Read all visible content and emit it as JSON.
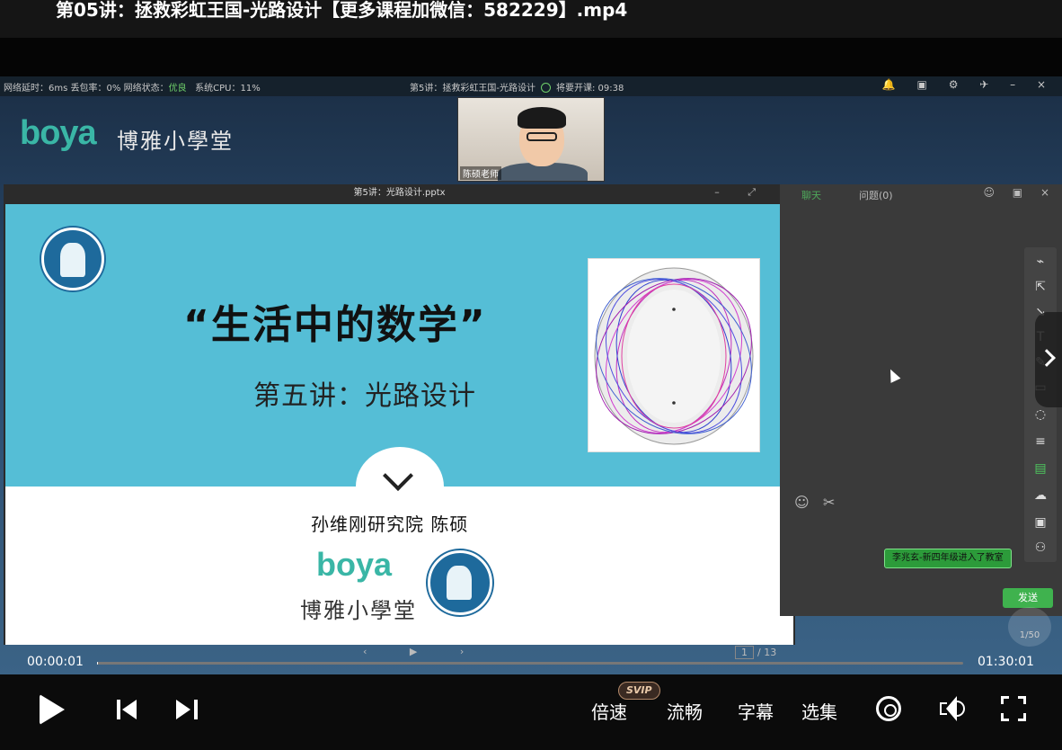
{
  "window": {
    "title": "第05讲：拯救彩虹王国-光路设计【更多课程加微信：582229】.mp4"
  },
  "classroom": {
    "status": {
      "latency_label": "网络延时：",
      "latency_value": "6ms",
      "loss_label": "丢包率：",
      "loss_value": "0%",
      "net_label": "网络状态：",
      "net_value": "优良",
      "cpu_label": "系统CPU：",
      "cpu_value": "11%"
    },
    "lesson_title": "第5讲：拯救彩虹王国-光路设计",
    "countdown": "将要开课: 09:38",
    "window_icons": "🔔 ▣ ⚙ ✈ – ×",
    "brand_en": "boya",
    "brand_cn": "博雅小學堂",
    "teacher_name": "陈硕老师",
    "ppt": {
      "filename": "第5讲：光路设计.pptx",
      "controls": "– ⤢",
      "slide": {
        "title": "“生活中的数学”",
        "subtitle": "第五讲：光路设计",
        "author": "孙维刚研究院   陈硕",
        "logo_en": "boya",
        "logo_cn": "博雅小學堂"
      },
      "nav_arrows": "‹ ▶ ›",
      "page_current": "1",
      "page_total": "/ 13"
    },
    "chat": {
      "tab_chat": "聊天",
      "tab_questions": "问题(0)",
      "panel_icons": "☺ ▣ ×",
      "emoji_icon": "☺",
      "scissors_icon": "✂",
      "notice": "李兆玄-新四年级进入了教室",
      "send": "发送"
    },
    "tools": [
      "⌁",
      "⇱",
      "↘",
      "T",
      "✎",
      "▭",
      "◌",
      "≡",
      "▤",
      "☁",
      "▣",
      "⚇"
    ],
    "mic_count": "1/50"
  },
  "player": {
    "current_time": "00:00:01",
    "total_time": "01:30:01",
    "progress_fraction": 0.0002,
    "speed_label": "倍速",
    "svip_badge": "SVIP",
    "quality_label": "流畅",
    "subtitle_label": "字幕",
    "episodes_label": "选集"
  }
}
